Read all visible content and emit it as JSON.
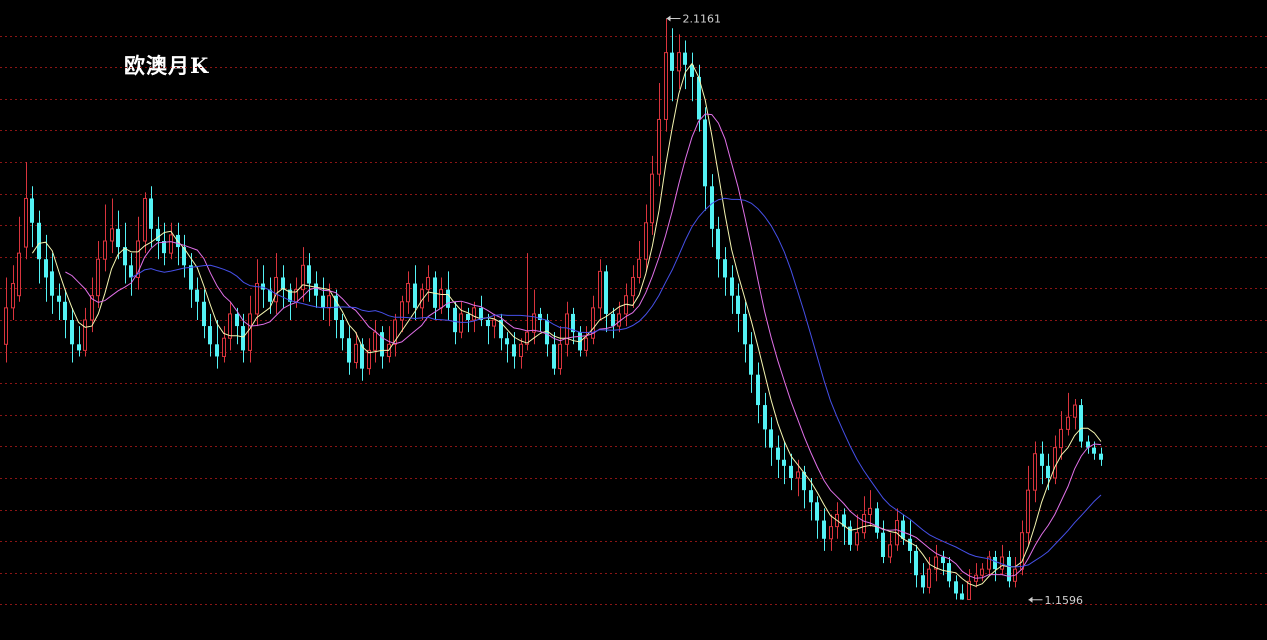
{
  "chart_data": {
    "type": "candlestick",
    "title": "欧澳月K",
    "ylim": [
      1.1,
      2.14
    ],
    "grid": true,
    "colors": {
      "up": "#d9343d",
      "down": "#54f2f5",
      "ma_short": "#f5f5b0",
      "ma_mid": "#e070e8",
      "ma_long": "#4650e8",
      "grid": "#8b1515",
      "annotation": "#d0d0d0"
    },
    "annotations": [
      {
        "text": "2.1161",
        "value": 2.1161,
        "bar": 100,
        "side": "high"
      },
      {
        "text": "1.1596",
        "value": 1.1596,
        "bar": 155,
        "side": "low"
      }
    ],
    "candles": [
      [
        1.58,
        1.64,
        1.69,
        1.55
      ],
      [
        1.64,
        1.68,
        1.71,
        1.62
      ],
      [
        1.66,
        1.73,
        1.79,
        1.65
      ],
      [
        1.74,
        1.82,
        1.88,
        1.72
      ],
      [
        1.82,
        1.78,
        1.84,
        1.74
      ],
      [
        1.78,
        1.72,
        1.8,
        1.68
      ],
      [
        1.72,
        1.69,
        1.76,
        1.65
      ],
      [
        1.7,
        1.66,
        1.73,
        1.63
      ],
      [
        1.66,
        1.65,
        1.68,
        1.62
      ],
      [
        1.65,
        1.62,
        1.67,
        1.59
      ],
      [
        1.62,
        1.58,
        1.64,
        1.55
      ],
      [
        1.58,
        1.57,
        1.61,
        1.56
      ],
      [
        1.57,
        1.62,
        1.64,
        1.56
      ],
      [
        1.62,
        1.66,
        1.69,
        1.6
      ],
      [
        1.66,
        1.72,
        1.75,
        1.64
      ],
      [
        1.72,
        1.75,
        1.81,
        1.7
      ],
      [
        1.75,
        1.77,
        1.82,
        1.73
      ],
      [
        1.77,
        1.74,
        1.8,
        1.72
      ],
      [
        1.74,
        1.71,
        1.78,
        1.68
      ],
      [
        1.71,
        1.69,
        1.73,
        1.66
      ],
      [
        1.69,
        1.75,
        1.79,
        1.67
      ],
      [
        1.75,
        1.82,
        1.83,
        1.73
      ],
      [
        1.82,
        1.77,
        1.84,
        1.74
      ],
      [
        1.77,
        1.75,
        1.79,
        1.72
      ],
      [
        1.75,
        1.73,
        1.78,
        1.71
      ],
      [
        1.73,
        1.76,
        1.78,
        1.72
      ],
      [
        1.76,
        1.74,
        1.78,
        1.71
      ],
      [
        1.74,
        1.71,
        1.76,
        1.69
      ],
      [
        1.71,
        1.67,
        1.73,
        1.64
      ],
      [
        1.67,
        1.65,
        1.69,
        1.62
      ],
      [
        1.65,
        1.61,
        1.67,
        1.59
      ],
      [
        1.61,
        1.58,
        1.63,
        1.56
      ],
      [
        1.58,
        1.56,
        1.62,
        1.54
      ],
      [
        1.56,
        1.59,
        1.61,
        1.55
      ],
      [
        1.59,
        1.63,
        1.65,
        1.57
      ],
      [
        1.63,
        1.61,
        1.64,
        1.58
      ],
      [
        1.61,
        1.57,
        1.63,
        1.55
      ],
      [
        1.57,
        1.63,
        1.66,
        1.55
      ],
      [
        1.63,
        1.68,
        1.72,
        1.61
      ],
      [
        1.68,
        1.67,
        1.71,
        1.64
      ],
      [
        1.67,
        1.65,
        1.69,
        1.63
      ],
      [
        1.65,
        1.69,
        1.73,
        1.63
      ],
      [
        1.69,
        1.67,
        1.71,
        1.64
      ],
      [
        1.67,
        1.65,
        1.68,
        1.62
      ],
      [
        1.65,
        1.67,
        1.69,
        1.64
      ],
      [
        1.67,
        1.71,
        1.74,
        1.65
      ],
      [
        1.71,
        1.68,
        1.73,
        1.65
      ],
      [
        1.68,
        1.66,
        1.7,
        1.64
      ],
      [
        1.66,
        1.64,
        1.69,
        1.62
      ],
      [
        1.64,
        1.66,
        1.68,
        1.61
      ],
      [
        1.66,
        1.62,
        1.67,
        1.59
      ],
      [
        1.62,
        1.59,
        1.63,
        1.57
      ],
      [
        1.59,
        1.55,
        1.61,
        1.53
      ],
      [
        1.55,
        1.58,
        1.6,
        1.54
      ],
      [
        1.58,
        1.54,
        1.59,
        1.52
      ],
      [
        1.54,
        1.57,
        1.59,
        1.53
      ],
      [
        1.57,
        1.6,
        1.62,
        1.55
      ],
      [
        1.6,
        1.56,
        1.61,
        1.54
      ],
      [
        1.56,
        1.58,
        1.61,
        1.55
      ],
      [
        1.58,
        1.62,
        1.63,
        1.56
      ],
      [
        1.62,
        1.65,
        1.66,
        1.6
      ],
      [
        1.65,
        1.68,
        1.7,
        1.63
      ],
      [
        1.68,
        1.64,
        1.71,
        1.62
      ],
      [
        1.64,
        1.67,
        1.68,
        1.62
      ],
      [
        1.67,
        1.69,
        1.71,
        1.65
      ],
      [
        1.69,
        1.64,
        1.7,
        1.62
      ],
      [
        1.64,
        1.67,
        1.69,
        1.63
      ],
      [
        1.67,
        1.64,
        1.7,
        1.62
      ],
      [
        1.64,
        1.6,
        1.65,
        1.58
      ],
      [
        1.6,
        1.63,
        1.65,
        1.59
      ],
      [
        1.63,
        1.62,
        1.64,
        1.6
      ],
      [
        1.62,
        1.64,
        1.65,
        1.6
      ],
      [
        1.64,
        1.62,
        1.66,
        1.61
      ],
      [
        1.62,
        1.61,
        1.63,
        1.58
      ],
      [
        1.61,
        1.62,
        1.63,
        1.59
      ],
      [
        1.62,
        1.59,
        1.63,
        1.57
      ],
      [
        1.59,
        1.58,
        1.6,
        1.55
      ],
      [
        1.58,
        1.56,
        1.6,
        1.54
      ],
      [
        1.56,
        1.58,
        1.59,
        1.54
      ],
      [
        1.58,
        1.6,
        1.73,
        1.57
      ],
      [
        1.6,
        1.63,
        1.67,
        1.58
      ],
      [
        1.63,
        1.62,
        1.64,
        1.6
      ],
      [
        1.62,
        1.58,
        1.63,
        1.56
      ],
      [
        1.58,
        1.54,
        1.6,
        1.53
      ],
      [
        1.54,
        1.58,
        1.61,
        1.53
      ],
      [
        1.58,
        1.63,
        1.65,
        1.56
      ],
      [
        1.63,
        1.6,
        1.64,
        1.58
      ],
      [
        1.6,
        1.57,
        1.61,
        1.56
      ],
      [
        1.57,
        1.59,
        1.61,
        1.56
      ],
      [
        1.59,
        1.64,
        1.66,
        1.58
      ],
      [
        1.64,
        1.7,
        1.72,
        1.62
      ],
      [
        1.7,
        1.63,
        1.71,
        1.6
      ],
      [
        1.63,
        1.61,
        1.64,
        1.59
      ],
      [
        1.61,
        1.63,
        1.65,
        1.6
      ],
      [
        1.63,
        1.66,
        1.68,
        1.61
      ],
      [
        1.66,
        1.69,
        1.71,
        1.64
      ],
      [
        1.69,
        1.72,
        1.75,
        1.68
      ],
      [
        1.72,
        1.78,
        1.81,
        1.7
      ],
      [
        1.78,
        1.86,
        1.89,
        1.76
      ],
      [
        1.86,
        1.95,
        2.01,
        1.84
      ],
      [
        1.95,
        2.06,
        2.116,
        1.93
      ],
      [
        2.06,
        2.03,
        2.1,
        1.98
      ],
      [
        2.03,
        2.06,
        2.09,
        2.0
      ],
      [
        2.06,
        2.04,
        2.08,
        2.0
      ],
      [
        2.04,
        2.02,
        2.06,
        1.98
      ],
      [
        2.02,
        1.95,
        2.04,
        1.93
      ],
      [
        1.95,
        1.84,
        1.97,
        1.8
      ],
      [
        1.84,
        1.77,
        1.86,
        1.74
      ],
      [
        1.77,
        1.72,
        1.79,
        1.69
      ],
      [
        1.72,
        1.69,
        1.74,
        1.66
      ],
      [
        1.69,
        1.66,
        1.71,
        1.63
      ],
      [
        1.66,
        1.63,
        1.68,
        1.6
      ],
      [
        1.63,
        1.58,
        1.65,
        1.55
      ],
      [
        1.58,
        1.53,
        1.6,
        1.5
      ],
      [
        1.53,
        1.48,
        1.55,
        1.45
      ],
      [
        1.48,
        1.44,
        1.5,
        1.41
      ],
      [
        1.44,
        1.41,
        1.46,
        1.38
      ],
      [
        1.41,
        1.39,
        1.43,
        1.36
      ],
      [
        1.39,
        1.38,
        1.42,
        1.35
      ],
      [
        1.38,
        1.36,
        1.4,
        1.34
      ],
      [
        1.36,
        1.37,
        1.39,
        1.33
      ],
      [
        1.37,
        1.34,
        1.38,
        1.31
      ],
      [
        1.34,
        1.32,
        1.36,
        1.29
      ],
      [
        1.32,
        1.29,
        1.33,
        1.26
      ],
      [
        1.29,
        1.26,
        1.31,
        1.24
      ],
      [
        1.26,
        1.28,
        1.3,
        1.24
      ],
      [
        1.28,
        1.3,
        1.32,
        1.26
      ],
      [
        1.3,
        1.28,
        1.31,
        1.25
      ],
      [
        1.28,
        1.25,
        1.29,
        1.24
      ],
      [
        1.25,
        1.27,
        1.3,
        1.24
      ],
      [
        1.27,
        1.3,
        1.33,
        1.26
      ],
      [
        1.3,
        1.31,
        1.34,
        1.28
      ],
      [
        1.31,
        1.27,
        1.32,
        1.26
      ],
      [
        1.27,
        1.23,
        1.29,
        1.22
      ],
      [
        1.23,
        1.25,
        1.27,
        1.22
      ],
      [
        1.25,
        1.29,
        1.31,
        1.24
      ],
      [
        1.29,
        1.26,
        1.3,
        1.25
      ],
      [
        1.26,
        1.24,
        1.29,
        1.22
      ],
      [
        1.24,
        1.2,
        1.25,
        1.18
      ],
      [
        1.2,
        1.18,
        1.22,
        1.17
      ],
      [
        1.18,
        1.21,
        1.23,
        1.17
      ],
      [
        1.21,
        1.23,
        1.25,
        1.19
      ],
      [
        1.23,
        1.22,
        1.24,
        1.2
      ],
      [
        1.22,
        1.19,
        1.23,
        1.18
      ],
      [
        1.19,
        1.17,
        1.2,
        1.16
      ],
      [
        1.17,
        1.16,
        1.185,
        1.1596
      ],
      [
        1.16,
        1.19,
        1.21,
        1.16
      ],
      [
        1.19,
        1.2,
        1.22,
        1.18
      ],
      [
        1.2,
        1.21,
        1.22,
        1.19
      ],
      [
        1.21,
        1.23,
        1.24,
        1.2
      ],
      [
        1.23,
        1.21,
        1.24,
        1.19
      ],
      [
        1.21,
        1.23,
        1.25,
        1.2
      ],
      [
        1.23,
        1.19,
        1.24,
        1.18
      ],
      [
        1.19,
        1.21,
        1.23,
        1.18
      ],
      [
        1.21,
        1.27,
        1.29,
        1.2
      ],
      [
        1.27,
        1.34,
        1.38,
        1.25
      ],
      [
        1.34,
        1.4,
        1.42,
        1.32
      ],
      [
        1.4,
        1.38,
        1.42,
        1.35
      ],
      [
        1.38,
        1.36,
        1.4,
        1.34
      ],
      [
        1.36,
        1.41,
        1.43,
        1.35
      ],
      [
        1.41,
        1.44,
        1.47,
        1.39
      ],
      [
        1.44,
        1.46,
        1.5,
        1.43
      ],
      [
        1.46,
        1.48,
        1.49,
        1.44
      ],
      [
        1.48,
        1.42,
        1.49,
        1.41
      ],
      [
        1.42,
        1.41,
        1.43,
        1.4
      ],
      [
        1.41,
        1.4,
        1.42,
        1.39
      ],
      [
        1.4,
        1.39,
        1.41,
        1.38
      ]
    ]
  }
}
